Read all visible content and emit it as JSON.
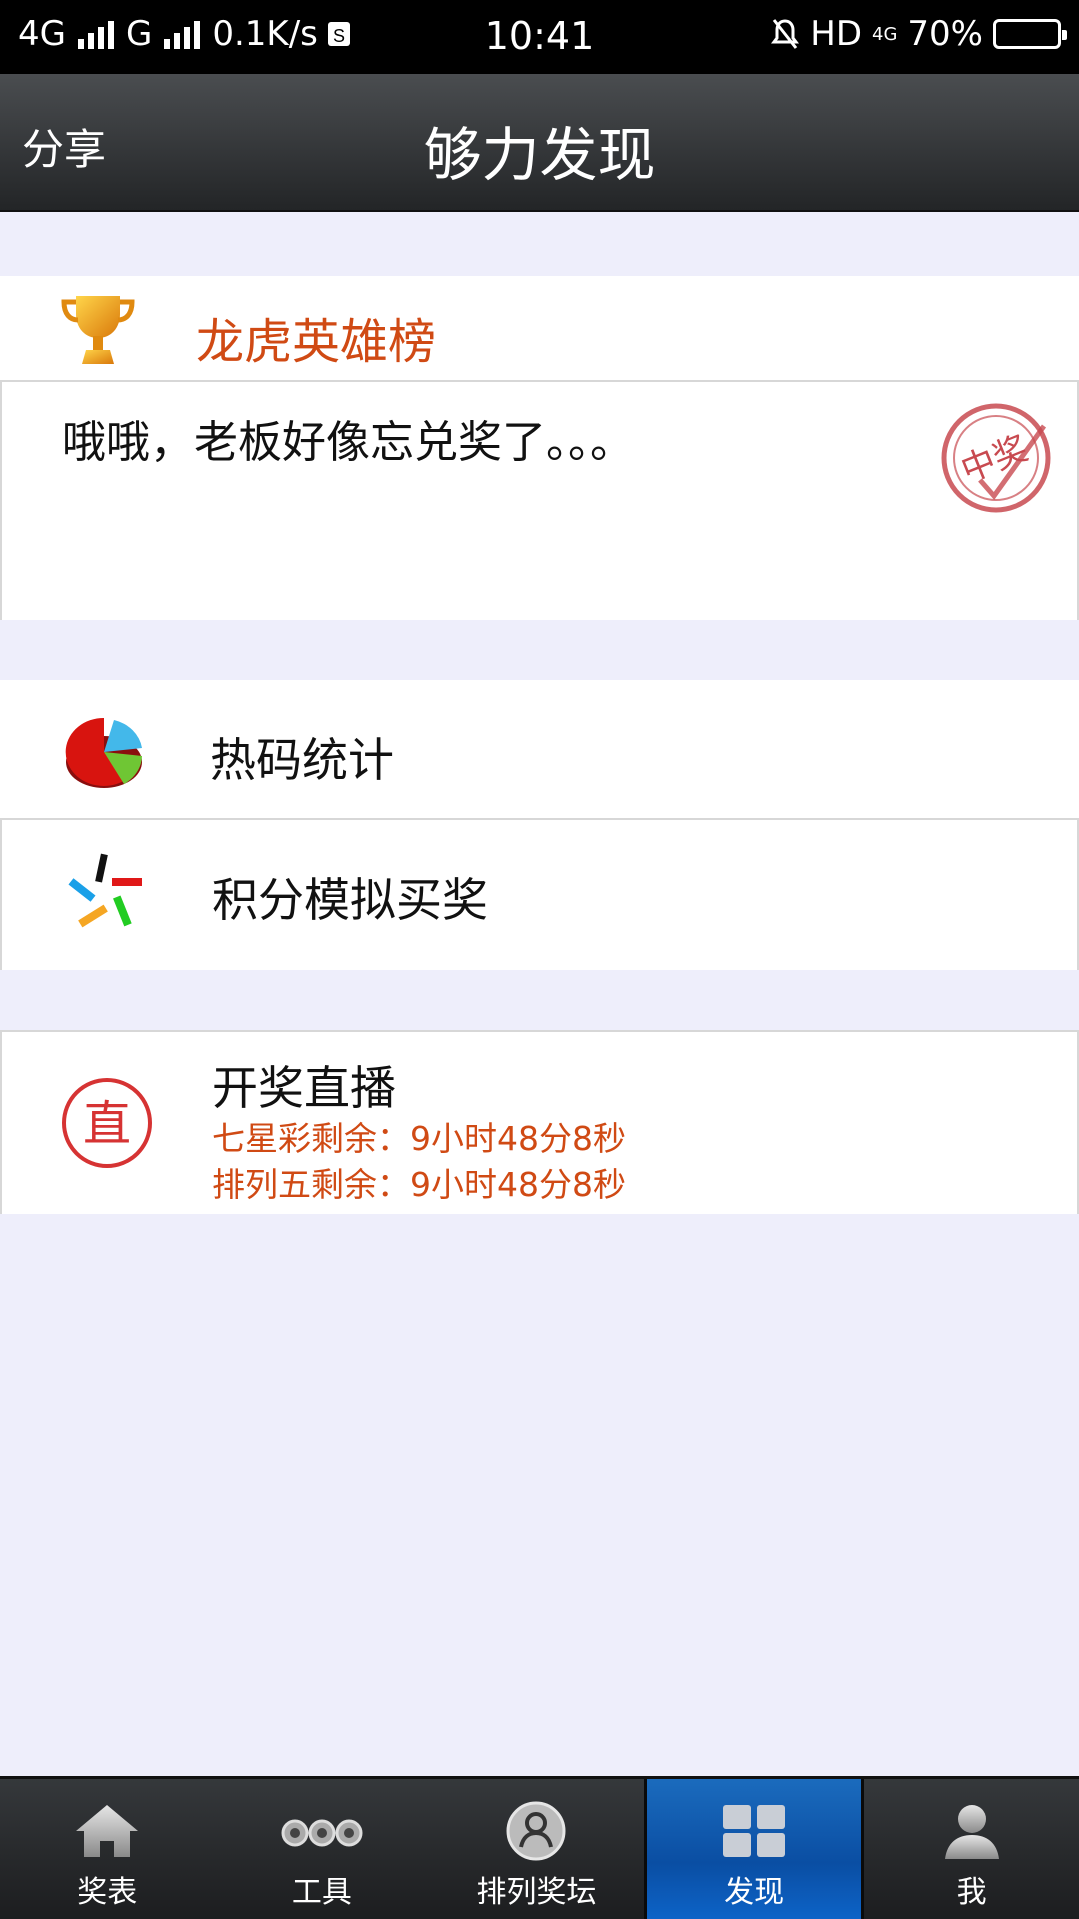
{
  "status_bar": {
    "network1": "4G",
    "network2": "G",
    "speed": "0.1K/s",
    "time": "10:41",
    "hd": "HD",
    "net_small": "4G",
    "battery": "70%"
  },
  "header": {
    "share_label": "分享",
    "title": "够力发现"
  },
  "hero": {
    "title": "龙虎英雄榜",
    "message": "哦哦，老板好像忘兑奖了。。。",
    "stamp_text": "中奖"
  },
  "menu": [
    {
      "label": "热码统计"
    },
    {
      "label": "积分模拟买奖"
    }
  ],
  "live": {
    "title": "开奖直播",
    "icon_text": "直",
    "line1": "七星彩剩余：9小时48分8秒",
    "line2": "排列五剩余：9小时48分8秒"
  },
  "tabs": [
    {
      "label": "奖表",
      "icon": "home-icon"
    },
    {
      "label": "工具",
      "icon": "tools-icon"
    },
    {
      "label": "排列奖坛",
      "icon": "forum-icon"
    },
    {
      "label": "发现",
      "icon": "grid-icon",
      "active": true
    },
    {
      "label": "我",
      "icon": "user-icon"
    }
  ],
  "colors": {
    "accent_orange": "#d04a14",
    "active_tab": "#0a4ea3",
    "header_dark": "#2c2e30",
    "background": "#eeeefb"
  }
}
